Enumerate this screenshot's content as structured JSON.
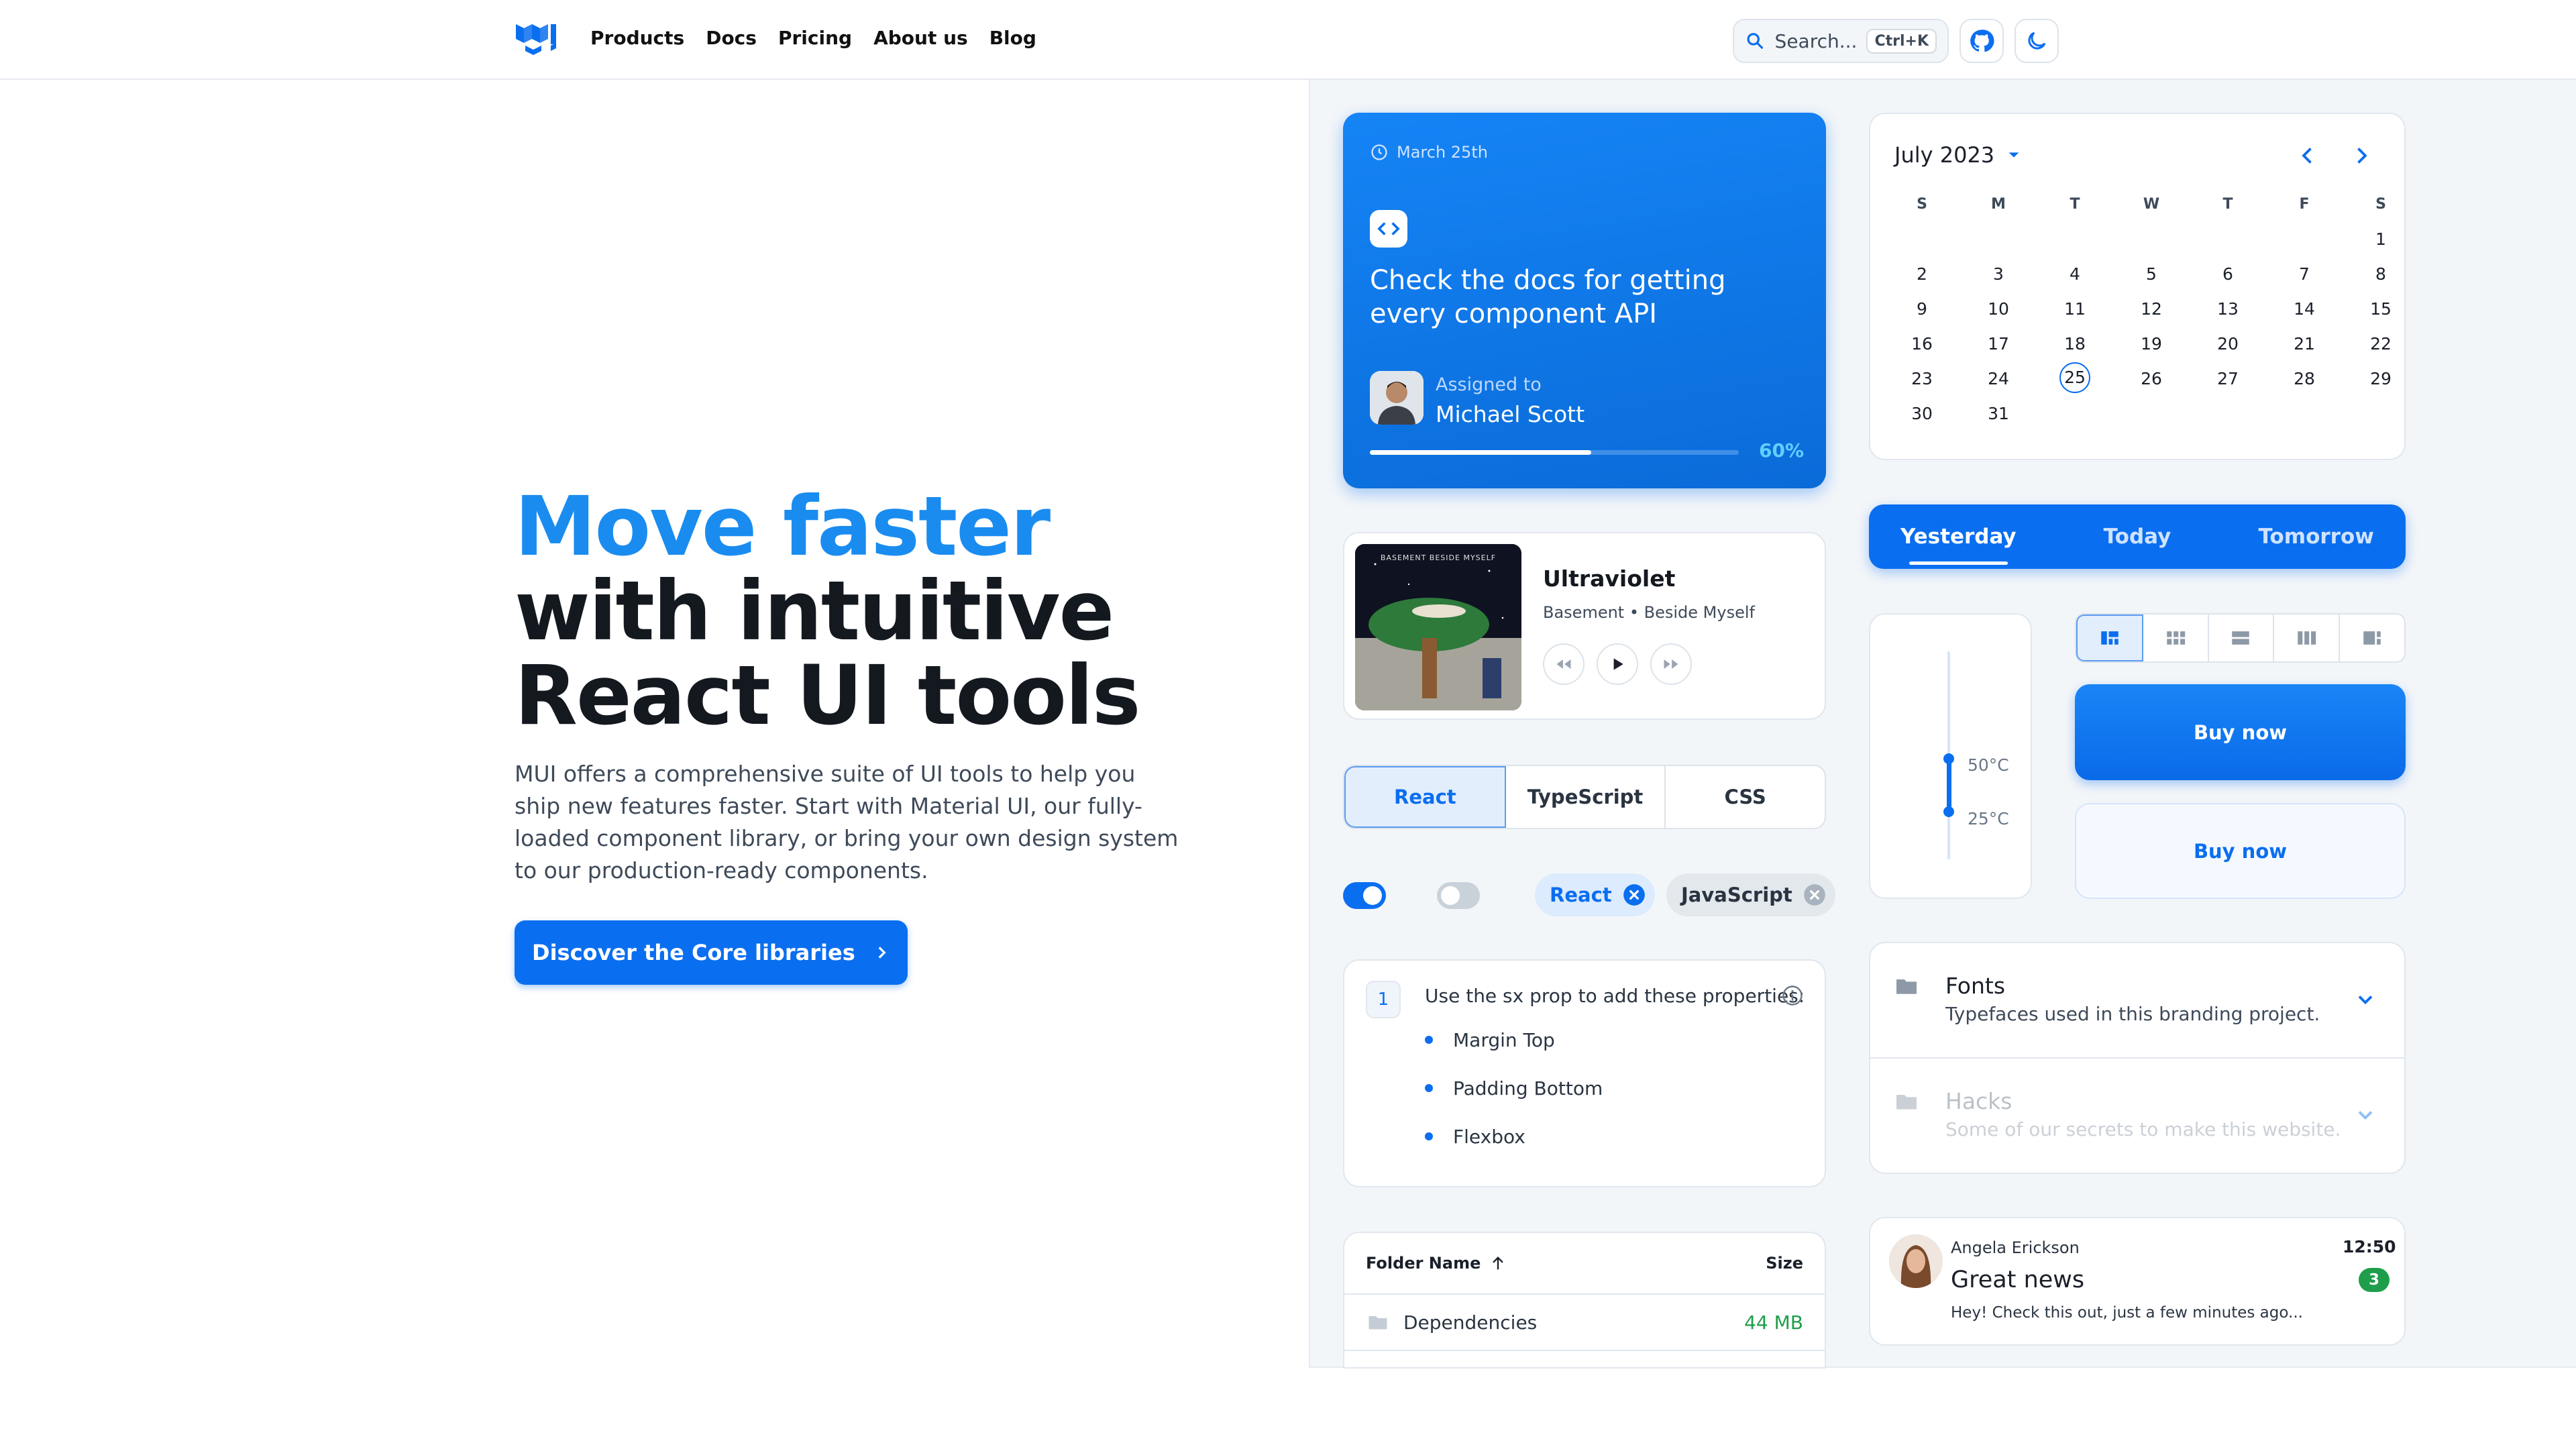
{
  "nav": {
    "links": [
      "Products",
      "Docs",
      "Pricing",
      "About us",
      "Blog"
    ],
    "search_label": "Search...",
    "search_shortcut": "Ctrl+K"
  },
  "hero": {
    "title_highlight": "Move faster",
    "title_line2": "with intuitive",
    "title_line3": "React UI tools",
    "description": "MUI offers a comprehensive suite of UI tools to help you ship new features faster. Start with Material UI, our fully-loaded component library, or bring your own design system to our production-ready components.",
    "cta_label": "Discover the Core libraries"
  },
  "task_card": {
    "date": "March 25th",
    "title": "Check the docs for getting every component API",
    "assigned_label": "Assigned to",
    "assignee": "Michael Scott",
    "progress_text": "60%",
    "progress": 0.6
  },
  "player": {
    "track": "Ultraviolet",
    "meta": "Basement • Beside Myself",
    "art_text": "BASEMENT BESIDE MYSELF"
  },
  "segmented": [
    "React",
    "TypeScript",
    "CSS"
  ],
  "chips": [
    "React",
    "JavaScript"
  ],
  "switches": {
    "first_on": true,
    "second_on": false
  },
  "steps": {
    "number": "1",
    "title": "Use the sx prop to add these properties:",
    "items": [
      "Margin Top",
      "Padding Bottom",
      "Flexbox"
    ]
  },
  "table": {
    "col_name": "Folder Name",
    "col_size": "Size",
    "rows": [
      {
        "name": "Dependencies",
        "size": "44 MB"
      }
    ]
  },
  "calendar": {
    "month": "July 2023",
    "weekdays": [
      "S",
      "M",
      "T",
      "W",
      "T",
      "F",
      "S"
    ],
    "weeks": [
      [
        "",
        "",
        "",
        "",
        "",
        "",
        "1"
      ],
      [
        "2",
        "3",
        "4",
        "5",
        "6",
        "7",
        "8"
      ],
      [
        "9",
        "10",
        "11",
        "12",
        "13",
        "14",
        "15"
      ],
      [
        "16",
        "17",
        "18",
        "19",
        "20",
        "21",
        "22"
      ],
      [
        "23",
        "24",
        "25",
        "26",
        "27",
        "28",
        "29"
      ],
      [
        "30",
        "31",
        "",
        "",
        "",
        "",
        ""
      ]
    ],
    "selected": "25"
  },
  "day_tabs": [
    "Yesterday",
    "Today",
    "Tomorrow"
  ],
  "slider": {
    "upper_label": "50°C",
    "lower_label": "25°C"
  },
  "buy_primary": "Buy now",
  "buy_secondary": "Buy now",
  "accordion": [
    {
      "title": "Fonts",
      "subtitle": "Typefaces used in this branding project."
    },
    {
      "title": "Hacks",
      "subtitle": "Some of our secrets to make this website."
    }
  ],
  "notification": {
    "sender": "Angela Erickson",
    "time": "12:50",
    "title": "Great news",
    "badge": "3",
    "preview": "Hey! Check this out, just a few minutes ago..."
  },
  "colors": {
    "primary": "#0A6EF0",
    "hero_highlight": "#1A8CF0",
    "success": "#1E9E4A"
  }
}
